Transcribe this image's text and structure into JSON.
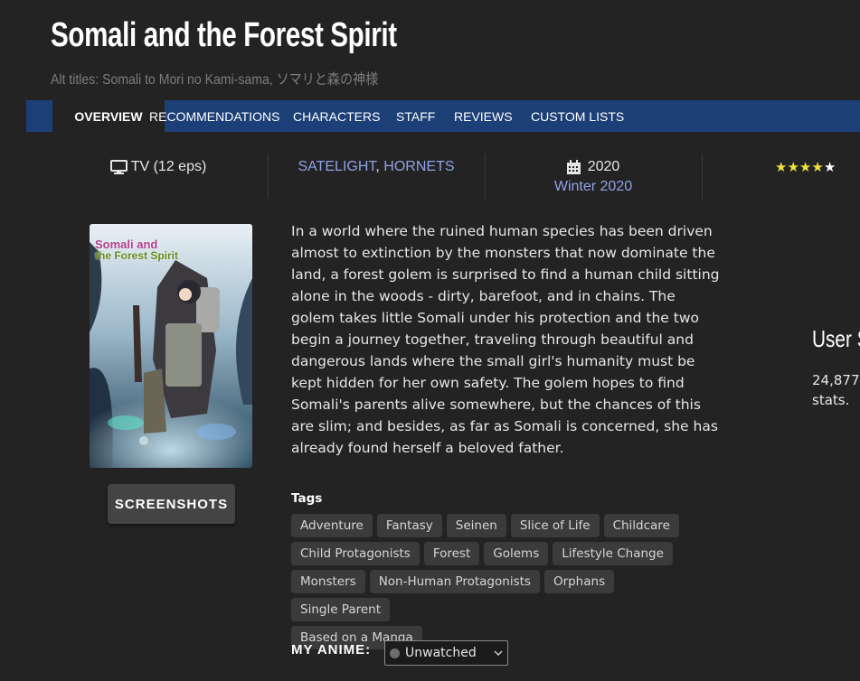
{
  "anime": {
    "title": "Somali and the Forest Spirit",
    "alt_titles": "Alt titles: Somali to Mori no Kami-sama, ソマリと森の神様"
  },
  "tabs": [
    {
      "label": "OVERVIEW",
      "active": true
    },
    {
      "label": "RECOMMENDATIONS"
    },
    {
      "label": "CHARACTERS"
    },
    {
      "label": "STAFF"
    },
    {
      "label": "REVIEWS"
    },
    {
      "label": "CUSTOM LISTS"
    }
  ],
  "info": {
    "format": "TV (12 eps)",
    "studios": [
      "SATELIGHT",
      "HORNETS"
    ],
    "studio_separator": ", ",
    "year": "2020",
    "season": "Winter 2020",
    "rating_stars": "★★★★★",
    "rating_value": 4.5
  },
  "icons": {
    "monitor": "monitor-icon",
    "calendar": "calendar-icon",
    "star": "star-icon",
    "chevron": "chevron-down-icon"
  },
  "synopsis": "In a world where the ruined human species has been driven almost to extinction by the monsters that now dominate the land, a forest golem is surprised to find a human child sitting alone in the woods - dirty, barefoot, and in chains. The golem takes little Somali under his protection and the two begin a journey together, traveling through beautiful and dangerous lands where the small girl's humanity must be kept hidden for her own safety. The golem hopes to find Somali's parents alive somewhere, but the chances of this are slim; and besides, as far as Somali is concerned, she has already found herself a beloved father.",
  "cover": {
    "logo_line1": "Somali and",
    "logo_line2": "the Forest Spirit"
  },
  "screenshots_button": "SCREENSHOTS",
  "user_stats": {
    "heading": "User S",
    "line1": "24,877",
    "line2": "stats."
  },
  "tags": {
    "label": "Tags",
    "items": [
      "Adventure",
      "Fantasy",
      "Seinen",
      "Slice of Life",
      "Childcare",
      "Child Protagonists",
      "Forest",
      "Golems",
      "Lifestyle Change",
      "Monsters",
      "Non-Human Protagonists",
      "Orphans",
      "Single Parent",
      "Based on a Manga"
    ]
  },
  "my_anime": {
    "label": "MY ANIME:",
    "status": "Unwatched"
  },
  "colors": {
    "background": "#232323",
    "tab_bar": "#1c3f78",
    "link": "#8fa2e6",
    "star": "#f2df3a"
  }
}
